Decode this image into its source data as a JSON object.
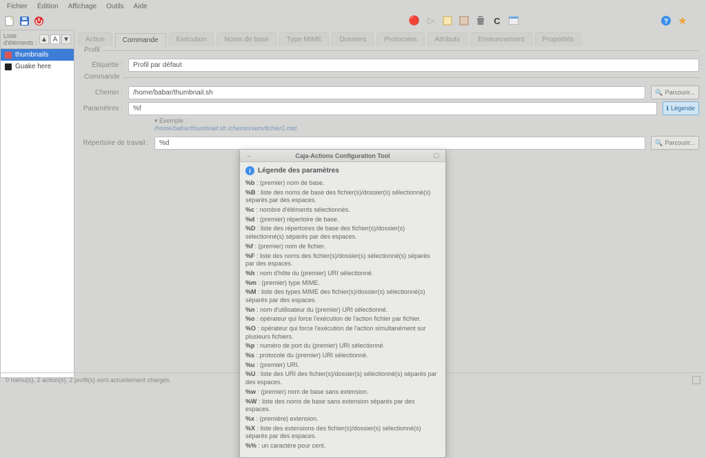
{
  "menubar": [
    "Fichier",
    "Édition",
    "Affichage",
    "Outils",
    "Aide"
  ],
  "toolbar": {
    "left_icons": [
      "doc-new-icon",
      "save-icon",
      "quit-icon"
    ],
    "center_icons": [
      "record-icon",
      "play-icon",
      "cut-icon",
      "copy-icon",
      "paste-icon",
      "delete-icon",
      "refresh-icon",
      "window-icon"
    ],
    "right_icons": [
      "help-icon",
      "star-icon"
    ]
  },
  "sidebar": {
    "title": "Liste d'éléments :",
    "items": [
      {
        "label": "thumbnails",
        "color": "#d55",
        "selected": true
      },
      {
        "label": "Guake here",
        "color": "#333",
        "selected": false
      }
    ]
  },
  "tabs": [
    "Action",
    "Commande",
    "Exécution",
    "Noms de base",
    "Type MIME",
    "Dossiers",
    "Protocoles",
    "Attributs",
    "Environnement",
    "Propriétés"
  ],
  "active_tab": 1,
  "profil": {
    "legend": "Profil",
    "label": "Étiquette :",
    "value": "Profil par défaut"
  },
  "commande": {
    "legend": "Commande",
    "path_label": "Chemin :",
    "path_value": "/home/babar/thumbnail.sh",
    "params_label": "Paramètres :",
    "params_value": "%f",
    "browse": "Parcourir...",
    "legend_btn": "Légende",
    "example_label": "Exemple :",
    "example_value": "/home/babar/thumbnail.sh /chemin/vers/fichier1.mid",
    "workdir_label": "Répertoire de travail :",
    "workdir_value": "%d"
  },
  "statusbar": "0 menu(s), 2 action(s), 2 profil(s) sont actuellement chargés.",
  "dialog": {
    "title": "Caja-Actions Configuration Tool",
    "heading": "Légende des paramètres",
    "items": [
      {
        "k": "%b",
        "v": "(premier) nom de base."
      },
      {
        "k": "%B",
        "v": "liste des noms de base des fichier(s)/dossier(s) sélectionné(s) séparés par des espaces."
      },
      {
        "k": "%c",
        "v": "nombre d'éléments sélectionnés."
      },
      {
        "k": "%d",
        "v": "(premier) répertoire de base."
      },
      {
        "k": "%D",
        "v": "liste des répertoires de base des fichier(s)/dossier(s) sélectionné(s) séparés par des espaces."
      },
      {
        "k": "%f",
        "v": "(premier) nom de fichier."
      },
      {
        "k": "%F",
        "v": "liste des noms des fichier(s)/dossier(s) sélectionné(s) séparés par des espaces."
      },
      {
        "k": "%h",
        "v": "nom d'hôte du (premier) URI sélectionné."
      },
      {
        "k": "%m",
        "v": "(premier) type MIME."
      },
      {
        "k": "%M",
        "v": "liste des types MIME des fichier(s)/dossier(s) sélectionné(s) séparés par des espaces."
      },
      {
        "k": "%n",
        "v": "nom d'utilisateur du (premier) URI sélectionné."
      },
      {
        "k": "%o",
        "v": "opérateur qui force l'exécution de l'action fichier par fichier."
      },
      {
        "k": "%O",
        "v": "opérateur qui force l'exécution de l'action simultanément sur plusieurs fichiers."
      },
      {
        "k": "%p",
        "v": "numéro de port du (premier) URI sélectionné."
      },
      {
        "k": "%s",
        "v": "protocole du (premier) URI sélectionné."
      },
      {
        "k": "%u",
        "v": "(premier) URI."
      },
      {
        "k": "%U",
        "v": "liste des URI des fichier(s)/dossier(s) sélectionné(s) séparés par des espaces."
      },
      {
        "k": "%w",
        "v": "(premier) nom de base sans extension."
      },
      {
        "k": "%W",
        "v": "liste des noms de base sans extension séparés par des espaces."
      },
      {
        "k": "%x",
        "v": "(première) extension."
      },
      {
        "k": "%X",
        "v": "liste des extensions des fichier(s)/dossier(s) sélectionné(s) séparés par des espaces."
      },
      {
        "k": "%%",
        "v": "un caractère pour cent."
      }
    ]
  }
}
